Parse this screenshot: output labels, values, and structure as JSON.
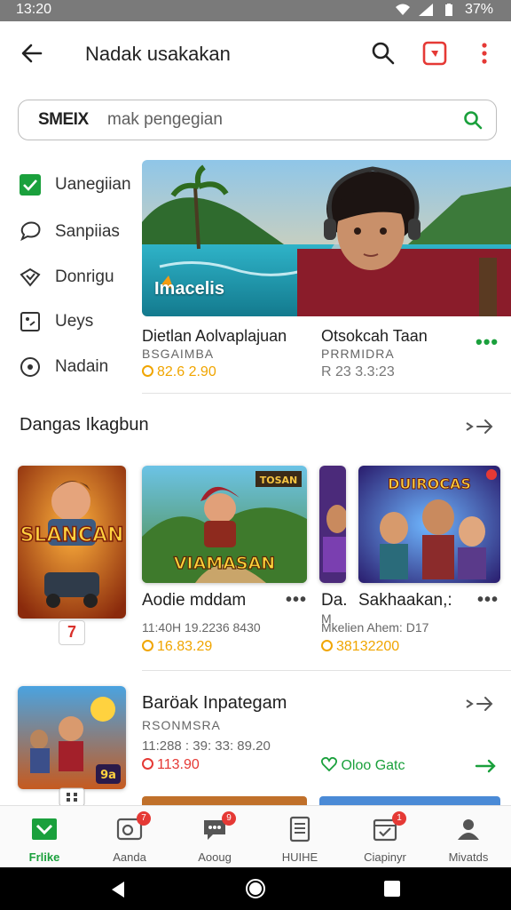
{
  "status_bar": {
    "time": "13:20",
    "battery": "37%"
  },
  "app_bar": {
    "title": "Nadak usakakan"
  },
  "search": {
    "prefix": "SMEIX",
    "placeholder": "mak pengegian"
  },
  "filters": [
    {
      "label": "Uanegiian",
      "icon": "checkbox-checked-icon"
    },
    {
      "label": "Sanpiias",
      "icon": "chat-bubble-icon"
    },
    {
      "label": "Donrigu",
      "icon": "heart-badge-icon"
    },
    {
      "label": "Ueys",
      "icon": "square-dot-icon"
    },
    {
      "label": "Nadain",
      "icon": "circle-dot-icon"
    }
  ],
  "hero": {
    "badge": "Imacelis"
  },
  "featured": [
    {
      "title": "Dietlan Aolvaplajuan",
      "subtitle": "BSGAIMBA",
      "price": "82.6 2.90"
    },
    {
      "title": "Otsokcah Taan",
      "subtitle": "PRRMIDRA",
      "price": "R 23 3.3:23"
    }
  ],
  "section1": {
    "title": "Dangas Ikagbun",
    "cards": [
      {
        "art_text": "SLANCAN",
        "rank": "7"
      },
      {
        "art_text": "VIAMASAN",
        "title": "Aodie mddam",
        "meta": "11:40H 19.2236 8430",
        "price": "16.83.29"
      },
      {
        "title": "Da.",
        "meta": "M",
        "price": ""
      },
      {
        "art_text": "DUIROCAS",
        "title": "Sakhaakan,:",
        "meta": "Mkelien Ahem: D17",
        "price": "38132200"
      }
    ]
  },
  "section2": {
    "title": "Baröak Inpategam",
    "subtitle": "RSONMSRA",
    "meta": "11:288 : 39: 33: 89.20",
    "price": "113.90",
    "promo": "Oloo Gatc",
    "art_badge": "9a"
  },
  "bottom_nav": [
    {
      "label": "Frlike",
      "active": true
    },
    {
      "label": "Aanda",
      "badge": "7"
    },
    {
      "label": "Aooug",
      "badge": "9"
    },
    {
      "label": "HUIHE"
    },
    {
      "label": "Ciapinyr",
      "badge": "1"
    },
    {
      "label": "Mivatds"
    }
  ],
  "colors": {
    "accent": "#1aa03c",
    "badge": "#e53935",
    "price": "#f0a500"
  }
}
